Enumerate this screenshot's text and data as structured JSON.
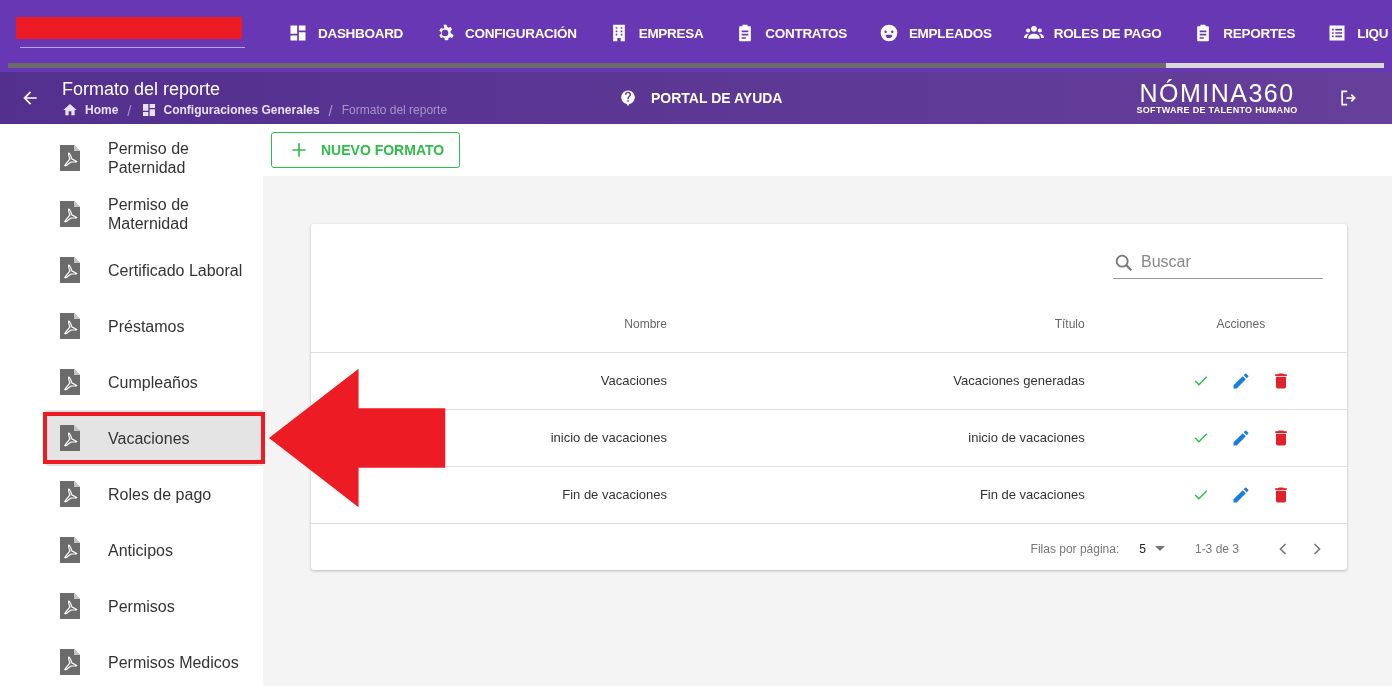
{
  "nav": {
    "items": [
      {
        "label": "DASHBOARD"
      },
      {
        "label": "CONFIGURACIÓN"
      },
      {
        "label": "EMPRESA"
      },
      {
        "label": "CONTRATOS"
      },
      {
        "label": "EMPLEADOS"
      },
      {
        "label": "ROLES DE PAGO"
      },
      {
        "label": "REPORTES"
      },
      {
        "label": "LIQU"
      }
    ]
  },
  "header": {
    "title": "Formato del reporte",
    "breadcrumbs": [
      {
        "label": "Home"
      },
      {
        "label": "Configuraciones Generales"
      },
      {
        "label": "Formato del reporte"
      }
    ],
    "separators": [
      "/",
      "/"
    ],
    "help": "PORTAL DE AYUDA",
    "logo": {
      "name": "NÓMINA360",
      "tagline": "SOFTWARE DE TALENTO HUMANO"
    }
  },
  "sidebar": {
    "items": [
      {
        "label": "Permiso de Paternidad",
        "selected": false
      },
      {
        "label": "Permiso de Maternidad",
        "selected": false
      },
      {
        "label": "Certificado Laboral",
        "selected": false
      },
      {
        "label": "Préstamos",
        "selected": false
      },
      {
        "label": "Cumpleaños",
        "selected": false
      },
      {
        "label": "Vacaciones",
        "selected": true
      },
      {
        "label": "Roles de pago",
        "selected": false
      },
      {
        "label": "Anticipos",
        "selected": false
      },
      {
        "label": "Permisos",
        "selected": false
      },
      {
        "label": "Permisos Medicos",
        "selected": false
      }
    ]
  },
  "toolbar": {
    "button": "NUEVO FORMATO"
  },
  "table": {
    "search": {
      "placeholder": "Buscar"
    },
    "columns": [
      "Nombre",
      "Título",
      "Acciones"
    ],
    "rows": [
      {
        "nombre": "Vacaciones",
        "titulo": "Vacaciones generadas"
      },
      {
        "nombre": "inicio de vacaciones",
        "titulo": "inicio de vacaciones"
      },
      {
        "nombre": "Fin de vacaciones",
        "titulo": "Fin de vacaciones"
      }
    ],
    "pagination": {
      "rows_label": "Filas por página:",
      "rows_per_page": "5",
      "range": "1-3 de 3"
    }
  }
}
